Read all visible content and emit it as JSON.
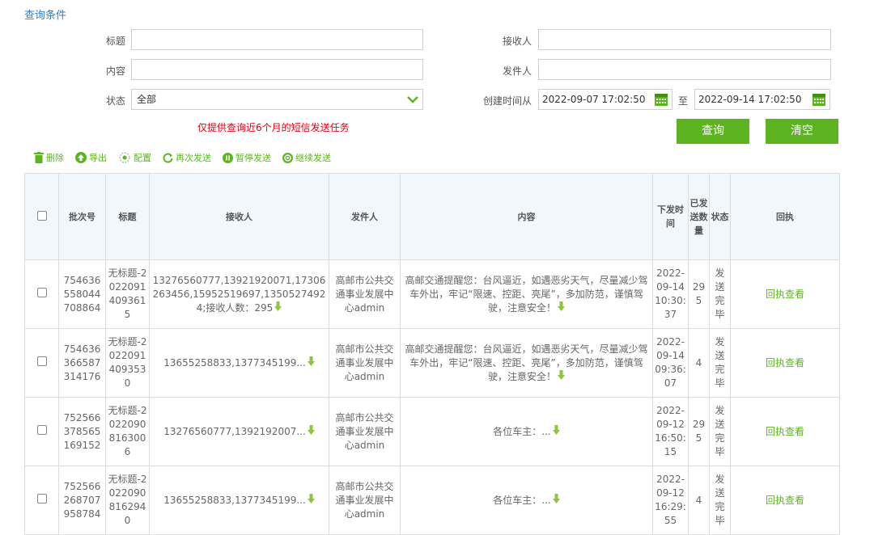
{
  "section_title": "查询条件",
  "filters": {
    "title_label": "标题",
    "receiver_label": "接收人",
    "content_label": "内容",
    "sender_label": "发件人",
    "status_label": "状态",
    "status_value": "全部",
    "created_from_label": "创建时间从",
    "date_from": "2022-09-07 17:02:50",
    "to_label": "至",
    "date_to": "2022-09-14 17:02:50"
  },
  "notice": "仅提供查询近6个月的短信发送任务",
  "buttons": {
    "query": "查询",
    "clear": "清空"
  },
  "toolbar": {
    "delete": "删除",
    "export": "导出",
    "config": "配置",
    "resend": "再次发送",
    "pause": "暂停发送",
    "resume": "继续发送"
  },
  "table": {
    "headers": {
      "batch": "批次号",
      "title": "标题",
      "receiver": "接收人",
      "sender": "发件人",
      "content": "内容",
      "sent_time": "下发时间",
      "sent_count": "已发送数量",
      "status": "状态",
      "receipt": "回执"
    },
    "rows": [
      {
        "batch": "754636558044708864",
        "title": "无标题-20220914093615",
        "receiver": "13276560777,13921920071,17306263456,15952519697,13505274924;接收人数：295",
        "sender": "高邮市公共交通事业发展中心admin",
        "content": "高邮交通提醒您：台风逼近，如遇恶劣天气，尽量减少驾车外出，牢记“限速、控距、亮尾”，多加防范，谨慎驾驶，注意安全！",
        "sent_time": "2022-09-14 10:30:37",
        "sent_count": "295",
        "status": "发送完毕",
        "receipt": "回执查看"
      },
      {
        "batch": "754636366587314176",
        "title": "无标题-20220914093530",
        "receiver": "13655258833,1377345199...",
        "sender": "高邮市公共交通事业发展中心admin",
        "content": "高邮交通提醒您：台风逼近，如遇恶劣天气，尽量减少驾车外出，牢记“限速、控距、亮尾”，多加防范，谨慎驾驶，注意安全！",
        "sent_time": "2022-09-14 09:36:07",
        "sent_count": "4",
        "status": "发送完毕",
        "receipt": "回执查看"
      },
      {
        "batch": "752566378565169152",
        "title": "无标题-20220908163006",
        "receiver": "13276560777,1392192007...",
        "sender": "高邮市公共交通事业发展中心admin",
        "content": "各位车主：...",
        "sent_time": "2022-09-12 16:50:15",
        "sent_count": "295",
        "status": "发送完毕",
        "receipt": "回执查看"
      },
      {
        "batch": "752566268707958784",
        "title": "无标题-20220908162940",
        "receiver": "13655258833,1377345199...",
        "sender": "高邮市公共交通事业发展中心admin",
        "content": "各位车主：...",
        "sent_time": "2022-09-12 16:29:55",
        "sent_count": "4",
        "status": "发送完毕",
        "receipt": "回执查看"
      }
    ]
  },
  "colors": {
    "accent": "#5cb520",
    "title_blue": "#2e7fc6",
    "warning": "#e60012"
  }
}
